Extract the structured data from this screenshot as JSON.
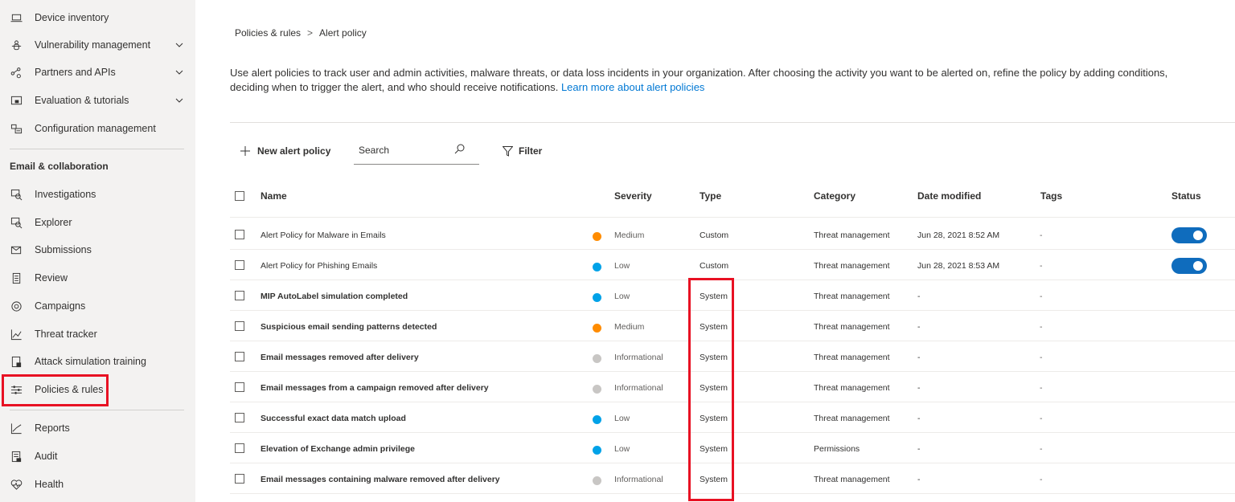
{
  "sidebar": {
    "items": [
      {
        "label": "Device inventory",
        "icon": "laptop-icon"
      },
      {
        "label": "Vulnerability management",
        "icon": "shield-bug-icon"
      },
      {
        "label": "Partners and APIs",
        "icon": "partners-icon"
      },
      {
        "label": "Evaluation & tutorials",
        "icon": "evaluation-icon"
      },
      {
        "label": "Configuration management",
        "icon": "config-icon"
      }
    ],
    "section_title": "Email & collaboration",
    "email_items": [
      {
        "label": "Investigations",
        "icon": "investigations-icon"
      },
      {
        "label": "Explorer",
        "icon": "explorer-icon"
      },
      {
        "label": "Submissions",
        "icon": "submissions-icon"
      },
      {
        "label": "Review",
        "icon": "review-icon"
      },
      {
        "label": "Campaigns",
        "icon": "campaigns-icon"
      },
      {
        "label": "Threat tracker",
        "icon": "threat-tracker-icon"
      },
      {
        "label": "Attack simulation training",
        "icon": "attack-sim-icon"
      },
      {
        "label": "Policies & rules",
        "icon": "policies-icon"
      }
    ],
    "bottom_items": [
      {
        "label": "Reports",
        "icon": "reports-icon"
      },
      {
        "label": "Audit",
        "icon": "audit-icon"
      },
      {
        "label": "Health",
        "icon": "health-icon"
      }
    ]
  },
  "breadcrumb": {
    "parent": "Policies & rules",
    "separator": ">",
    "current": "Alert policy"
  },
  "description": {
    "line1": "Use alert policies to track user and admin activities, malware threats, or data loss incidents in your organization. After choosing the activity you want to be alerted on, refine the policy by adding conditions,",
    "line2": "deciding when to trigger the alert, and who should receive notifications.",
    "link": "Learn more about alert policies"
  },
  "toolbar": {
    "new_policy_label": "New alert policy",
    "search_placeholder": "Search",
    "filter_label": "Filter"
  },
  "table": {
    "headers": {
      "name": "Name",
      "severity": "Severity",
      "type": "Type",
      "category": "Category",
      "date": "Date modified",
      "tags": "Tags",
      "status": "Status"
    },
    "rows": [
      {
        "name": "Alert Policy for Malware in Emails",
        "severity": "Medium",
        "type": "Custom",
        "category": "Threat management",
        "date": "Jun 28, 2021 8:52 AM",
        "tags": "-",
        "status_on": true
      },
      {
        "name": "Alert Policy for Phishing Emails",
        "severity": "Low",
        "type": "Custom",
        "category": "Threat management",
        "date": "Jun 28, 2021 8:53 AM",
        "tags": "-",
        "status_on": true
      },
      {
        "name": "MIP AutoLabel simulation completed",
        "severity": "Low",
        "type": "System",
        "category": "Threat management",
        "date": "-",
        "tags": "-",
        "status_on": false
      },
      {
        "name": "Suspicious email sending patterns detected",
        "severity": "Medium",
        "type": "System",
        "category": "Threat management",
        "date": "-",
        "tags": "-",
        "status_on": false
      },
      {
        "name": "Email messages removed after delivery",
        "severity": "Informational",
        "type": "System",
        "category": "Threat management",
        "date": "-",
        "tags": "-",
        "status_on": false
      },
      {
        "name": "Email messages from a campaign removed after delivery",
        "severity": "Informational",
        "type": "System",
        "category": "Threat management",
        "date": "-",
        "tags": "-",
        "status_on": false
      },
      {
        "name": "Successful exact data match upload",
        "severity": "Low",
        "type": "System",
        "category": "Threat management",
        "date": "-",
        "tags": "-",
        "status_on": false
      },
      {
        "name": "Elevation of Exchange admin privilege",
        "severity": "Low",
        "type": "System",
        "category": "Permissions",
        "date": "-",
        "tags": "-",
        "status_on": false
      },
      {
        "name": "Email messages containing malware removed after delivery",
        "severity": "Informational",
        "type": "System",
        "category": "Threat management",
        "date": "-",
        "tags": "-",
        "status_on": false
      }
    ]
  },
  "colors": {
    "medium": "#ff8c00",
    "low": "#00a2e8",
    "informational": "#c8c6c4",
    "highlight": "#e81123",
    "toggle_on": "#0f6cbd",
    "link": "#0078d4"
  }
}
